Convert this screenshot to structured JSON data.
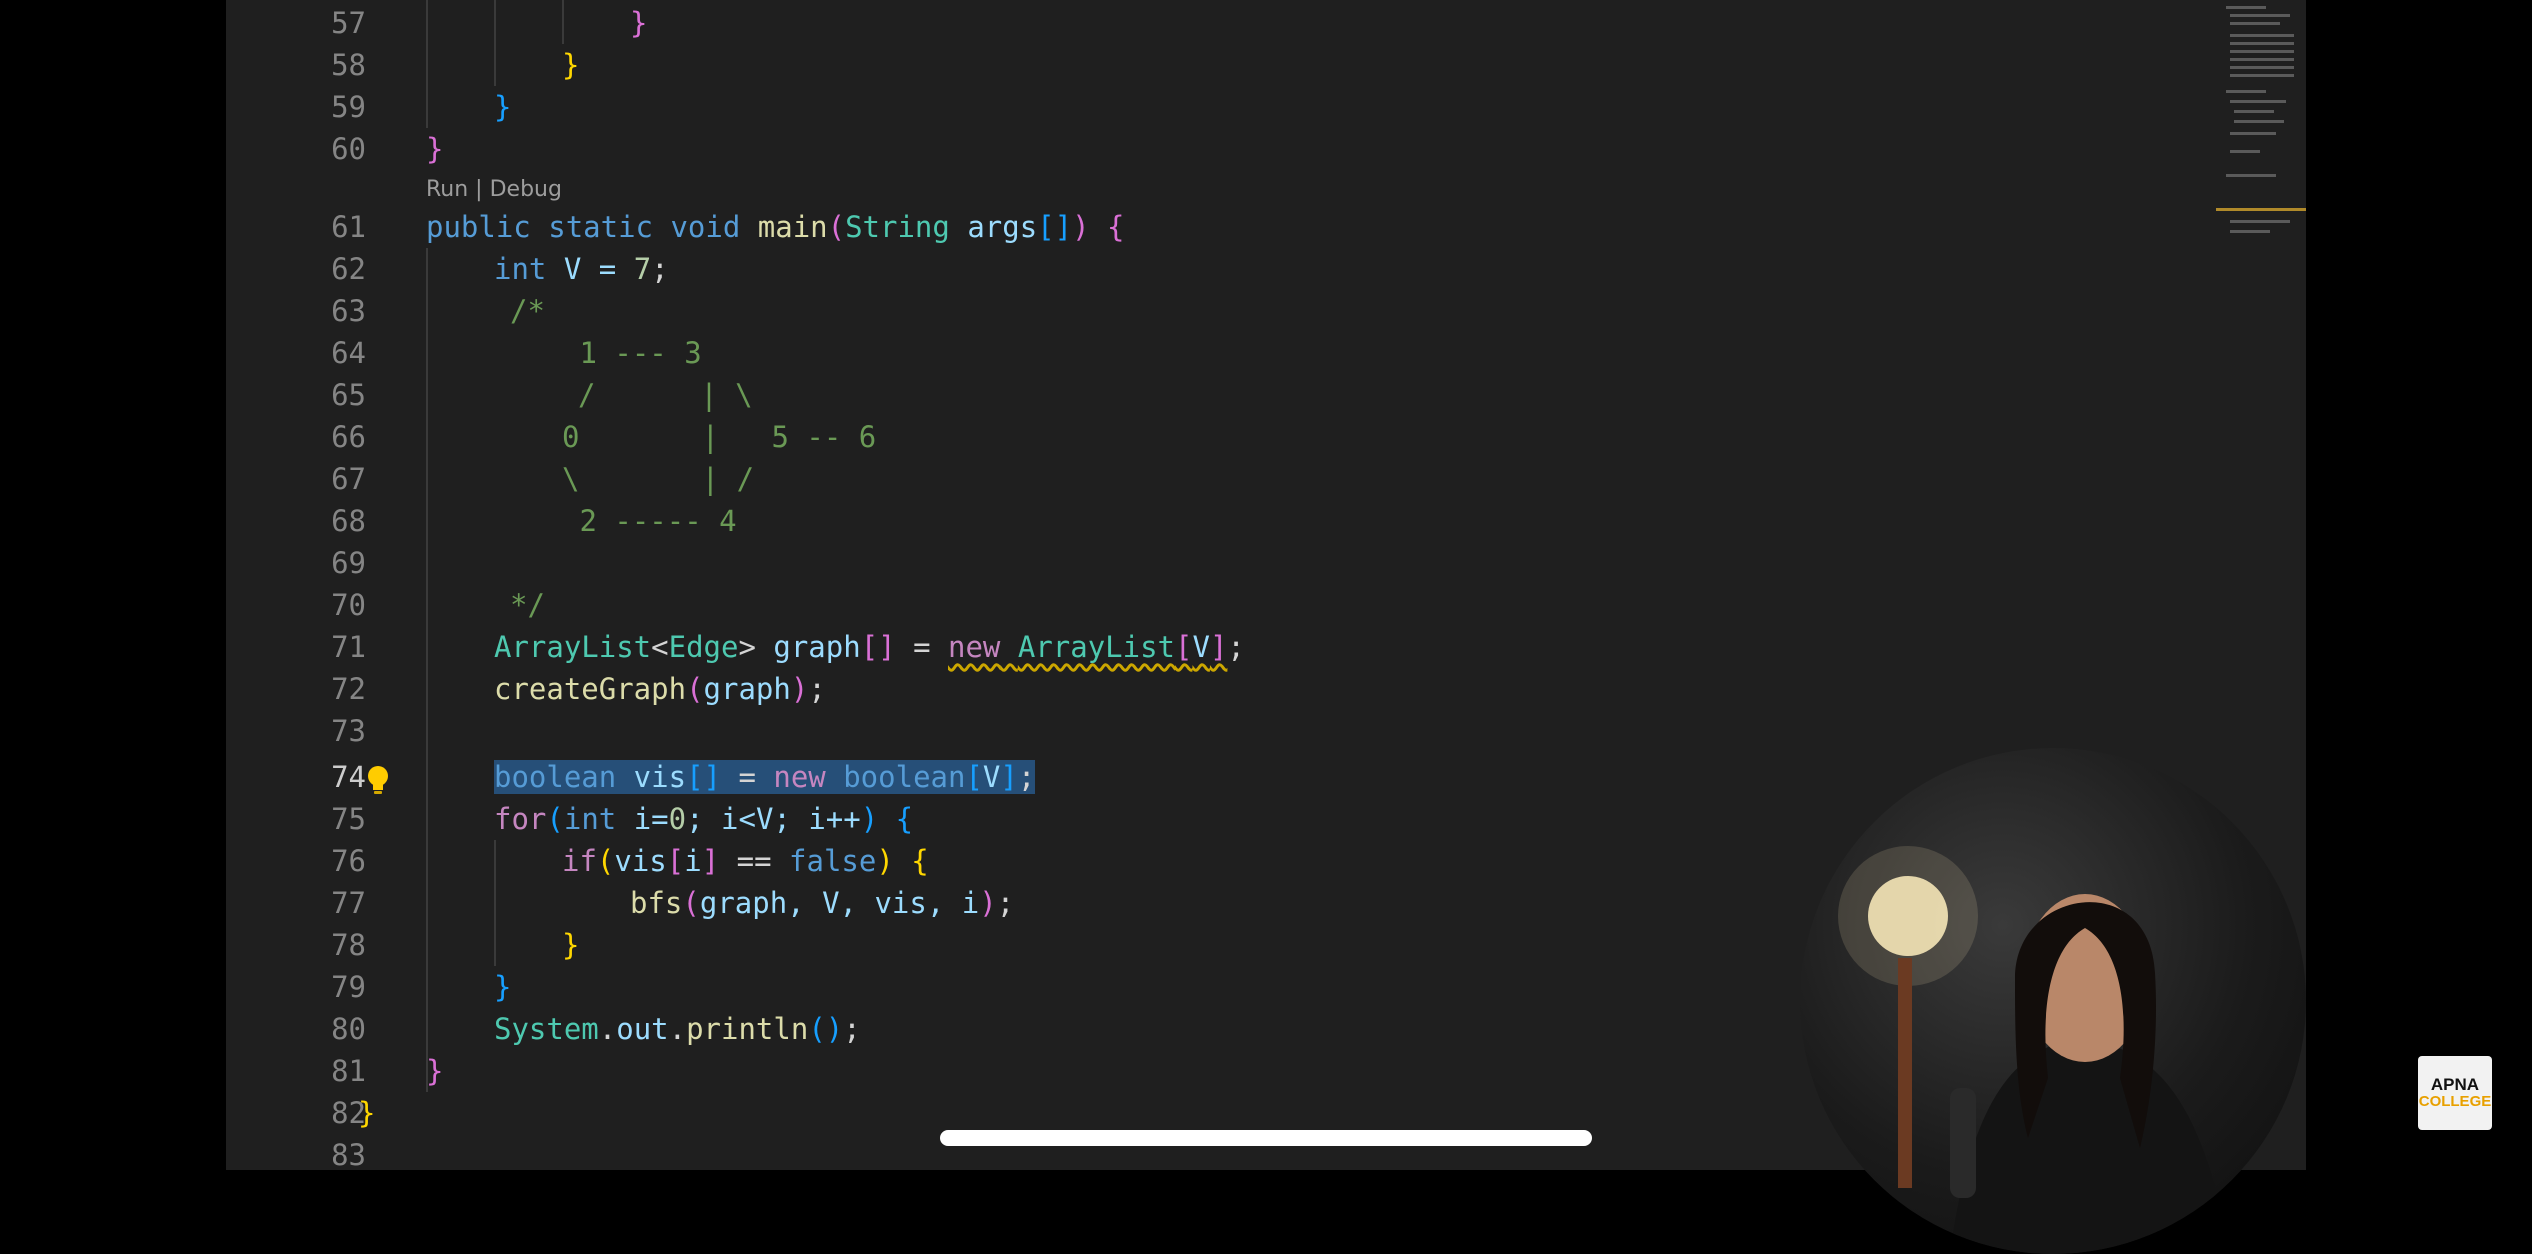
{
  "codelens": {
    "run": "Run",
    "sep": " | ",
    "debug": "Debug"
  },
  "line_numbers": [
    "57",
    "58",
    "59",
    "60",
    "61",
    "62",
    "63",
    "64",
    "65",
    "66",
    "67",
    "68",
    "69",
    "70",
    "71",
    "72",
    "73",
    "74",
    "75",
    "76",
    "77",
    "78",
    "79",
    "80",
    "81",
    "82",
    "83"
  ],
  "active_line": "74",
  "code": {
    "l57": "}",
    "l58": "}",
    "l59": "}",
    "l60": "}",
    "l61": {
      "kw1": "public",
      "kw2": "static",
      "kw3": "void",
      "fn": "main",
      "p1": "(",
      "ty": "String",
      "va": "args",
      "br": "[]",
      "p2": ")",
      "ob": "{"
    },
    "l62": {
      "kw": "int",
      "rest": " V = ",
      "num": "7",
      "end": ";"
    },
    "l63": "/*",
    "l64": " 1 --- 3",
    "l65": "/      | \\",
    "l66": "0       |   5 -- 6",
    "l67": "\\       | /",
    "l68": " 2 ----- 4",
    "l70": "*/",
    "l71": {
      "ty1": "ArrayList",
      "lt": "<",
      "ty2": "Edge",
      "gt": ">",
      "va": " graph",
      "br1": "[]",
      "eq": " = ",
      "kw": "new",
      "sp": " ",
      "ty3": "ArrayList",
      "br2": "[",
      "v": "V",
      "br3": "]",
      "end": ";"
    },
    "l72": {
      "fn": "createGraph",
      "p1": "(",
      "va": "graph",
      "p2": ")",
      "end": ";"
    },
    "l74": {
      "kw": "boolean",
      "va": " vis",
      "br": "[]",
      "eq": " = ",
      "kw2": "new",
      "kw3": " boolean",
      "b1": "[",
      "v": "V",
      "b2": "]",
      "end": ";"
    },
    "l75": {
      "kw": "for",
      "p1": "(",
      "kw2": "int",
      "rest": " i=",
      "n0": "0",
      "mid": "; i<V; i++",
      "p2": ")",
      "ob": " {"
    },
    "l76": {
      "kw": "if",
      "p1": "(",
      "va": "vis",
      "b1": "[",
      "i": "i",
      "b2": "]",
      "eq": " == ",
      "kw2": "false",
      "p2": ")",
      "ob": " {"
    },
    "l77": {
      "fn": "bfs",
      "p1": "(",
      "args": "graph, V, vis, i",
      "p2": ")",
      "end": ";"
    },
    "l78": "}",
    "l79": "}",
    "l80": {
      "ty": "System",
      "d1": ".",
      "va": "out",
      "d2": ".",
      "fn": "println",
      "p": "()",
      "end": ";"
    },
    "l81": "}",
    "l82": "}"
  },
  "logo": {
    "line1": "APNA",
    "line2": "COLLEGE"
  },
  "colors": {
    "background": "#1f1f1f",
    "selection": "#264f78",
    "keyword": "#569cd6",
    "control": "#c586c0",
    "type": "#4ec9b0",
    "function": "#dcdcaa",
    "variable": "#9cdcfe",
    "number": "#b5cea8",
    "comment": "#6a9955"
  }
}
